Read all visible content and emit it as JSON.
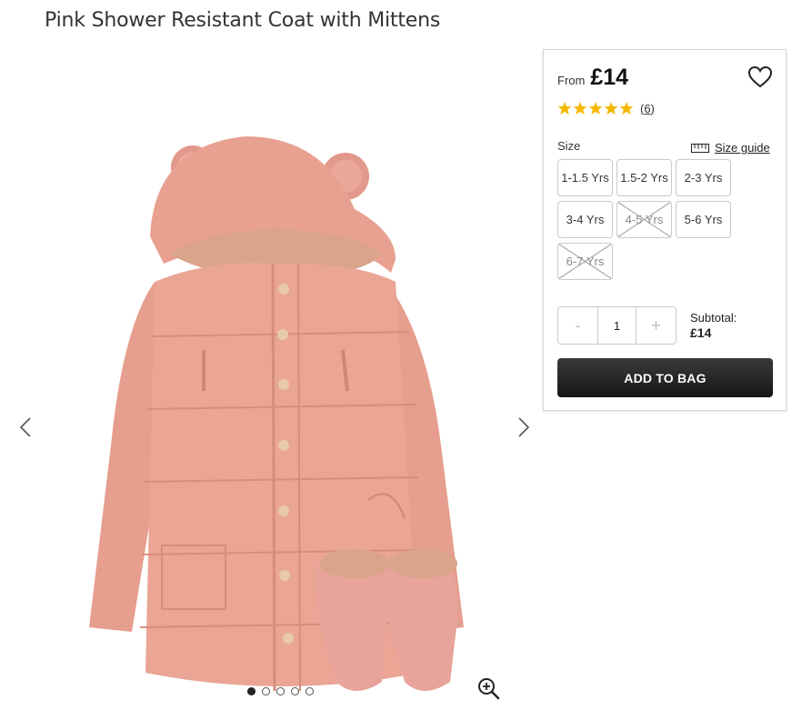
{
  "product": {
    "title": "Pink Shower Resistant Coat with Mittens"
  },
  "gallery": {
    "prev_icon": "chevron-left-icon",
    "next_icon": "chevron-right-icon",
    "zoom_icon": "zoom-in-icon",
    "dots_count": 5,
    "active_dot": 1
  },
  "panel": {
    "from_label": "From",
    "price": "£14",
    "wishlist_icon": "heart-icon",
    "rating": 5,
    "review_count": "(6)",
    "size_label": "Size",
    "size_guide_label": "Size guide",
    "sizes": [
      {
        "label": "1-1.5 Yrs",
        "available": true
      },
      {
        "label": "1.5-2 Yrs",
        "available": true
      },
      {
        "label": "2-3 Yrs",
        "available": true
      },
      {
        "label": "3-4 Yrs",
        "available": true
      },
      {
        "label": "4-5 Yrs",
        "available": false
      },
      {
        "label": "5-6 Yrs",
        "available": true
      },
      {
        "label": "6-7 Yrs",
        "available": false
      }
    ],
    "qty_minus": "-",
    "qty_value": "1",
    "qty_plus": "+",
    "subtotal_label": "Subtotal:",
    "subtotal_value": "£14",
    "add_to_bag": "ADD TO BAG"
  },
  "colors": {
    "coat": "#e8a090",
    "star": "#f5b800",
    "button_dark": "#1e1e1e"
  }
}
